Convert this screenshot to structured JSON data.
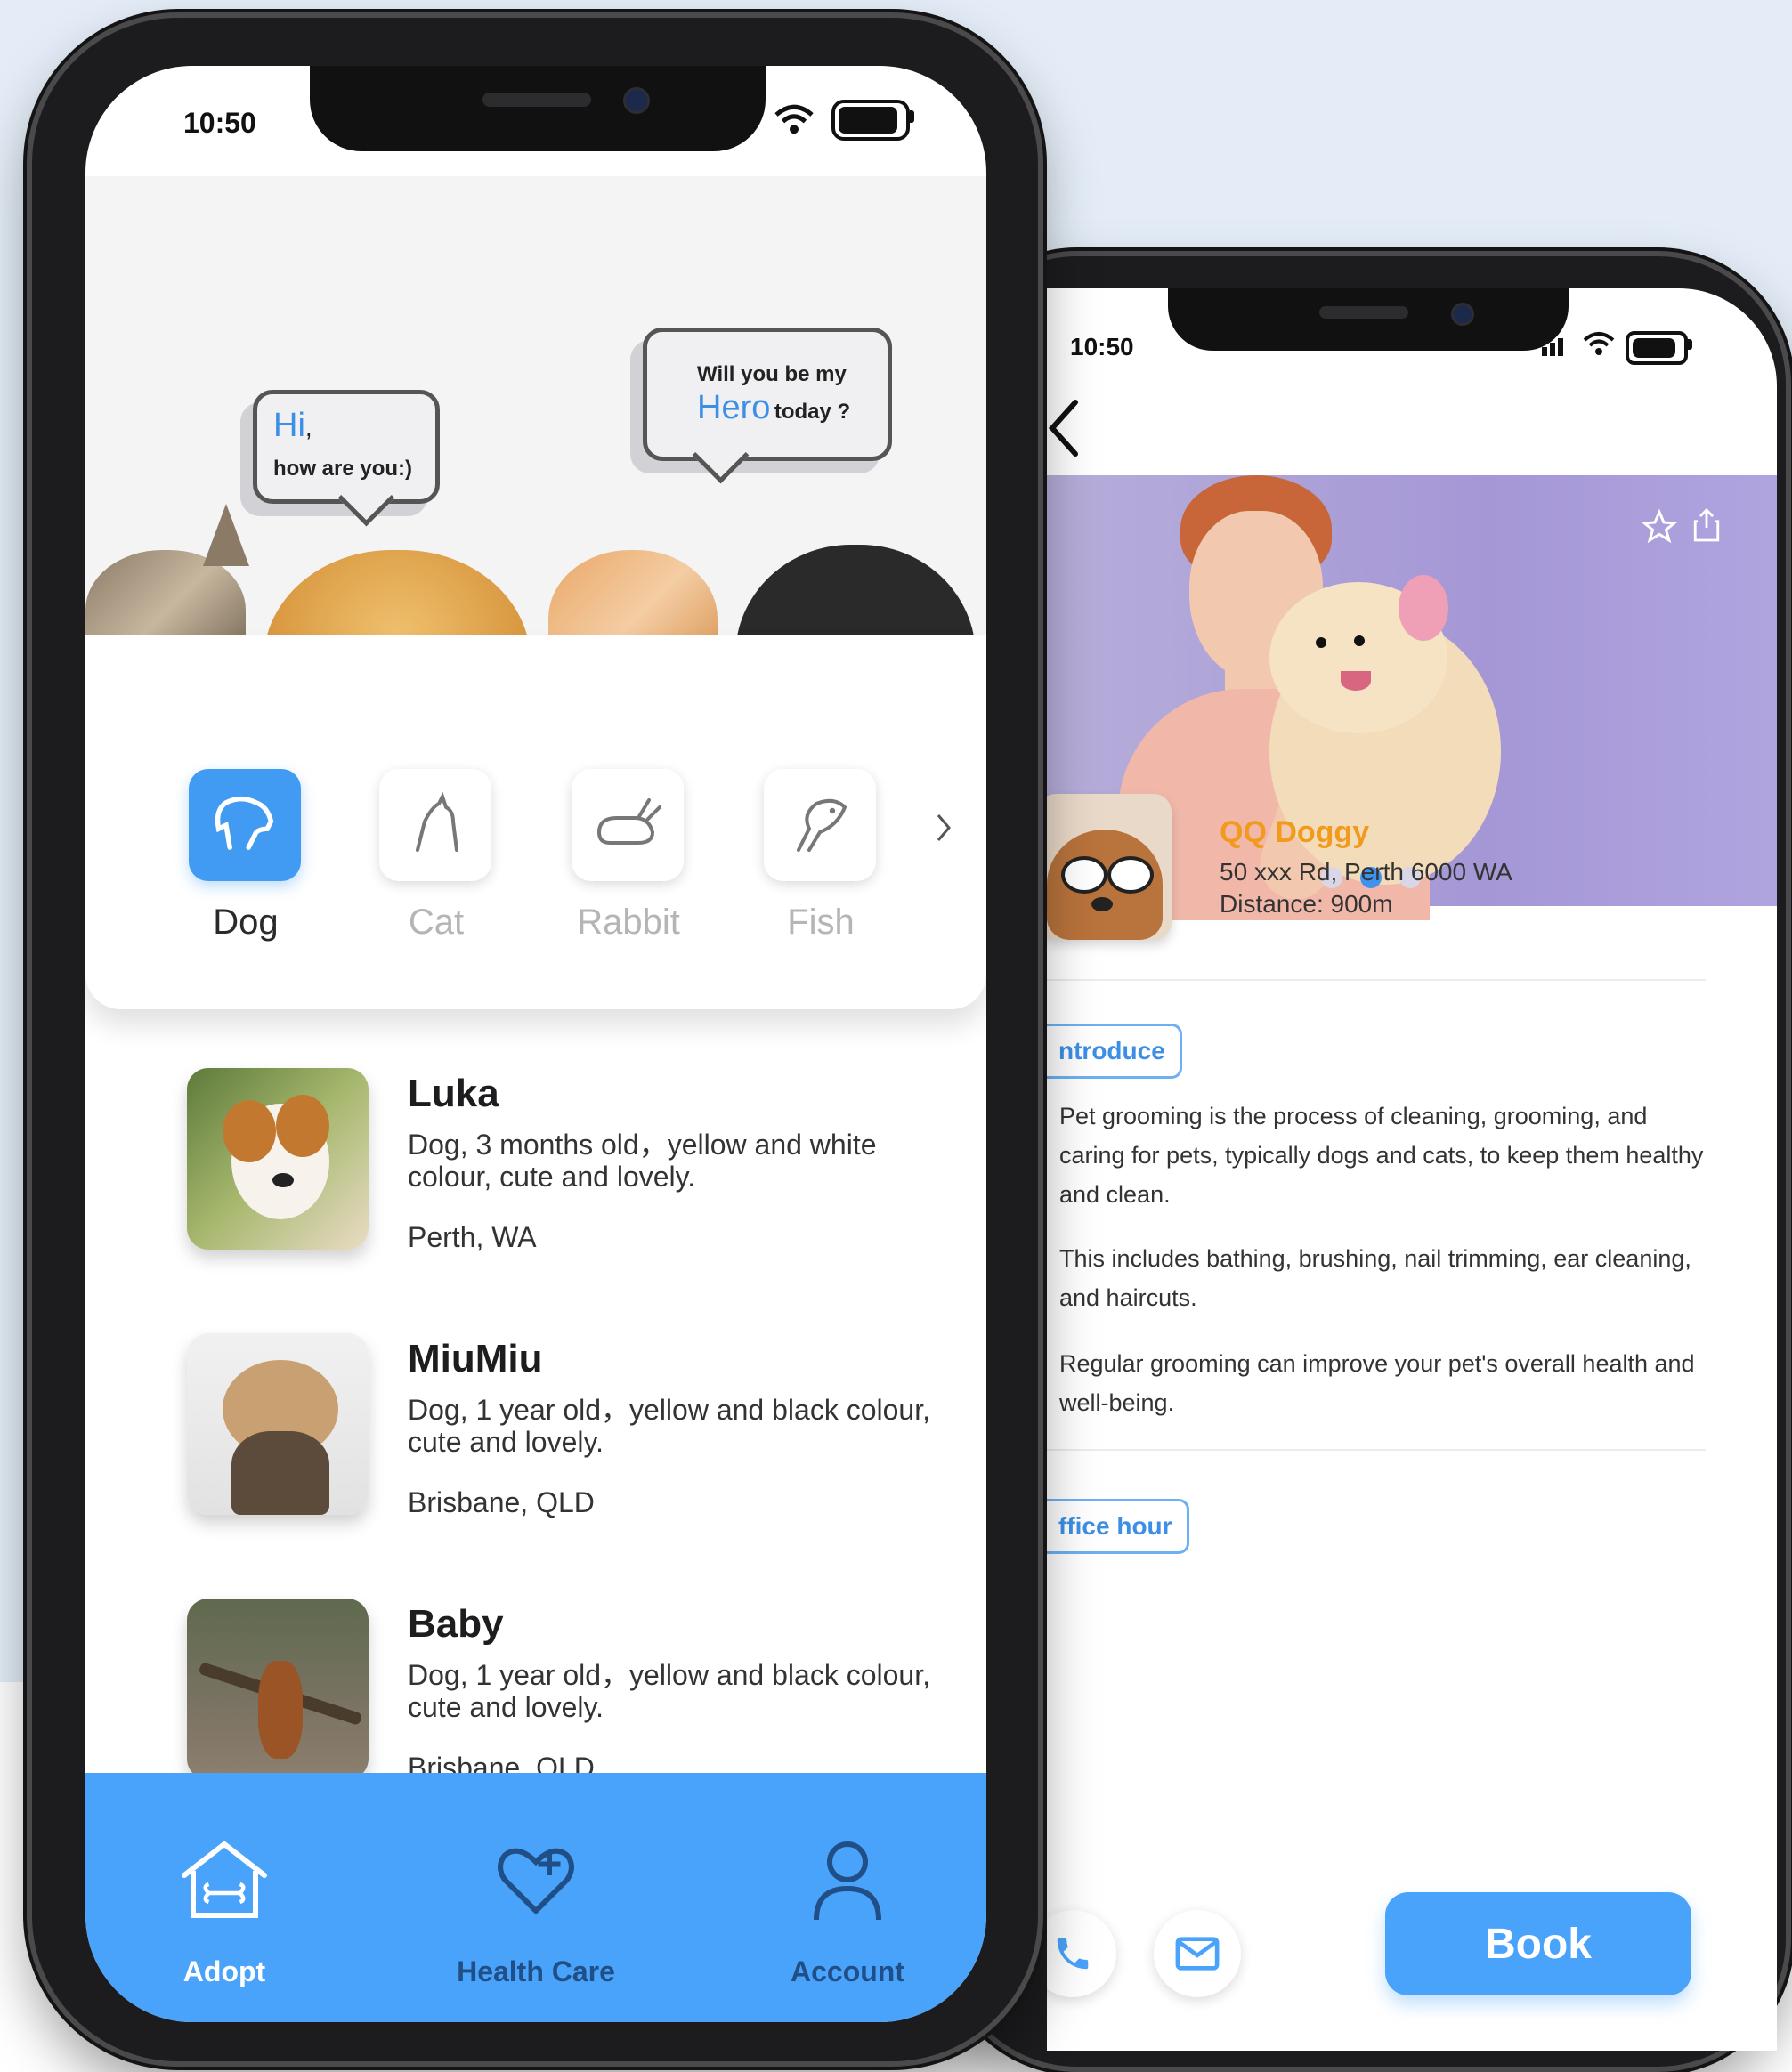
{
  "left_phone": {
    "status": {
      "time": "10:50"
    },
    "speech": {
      "left": {
        "greeting": "Hi",
        "comma": ",",
        "line2": "how are you:)"
      },
      "right": {
        "line1": "Will you be my",
        "hero": "Hero",
        "line2": "today ?"
      }
    },
    "categories": [
      {
        "label": "Dog",
        "icon": "dog-icon",
        "active": true
      },
      {
        "label": "Cat",
        "icon": "cat-icon",
        "active": false
      },
      {
        "label": "Rabbit",
        "icon": "rabbit-icon",
        "active": false
      },
      {
        "label": "Fish",
        "icon": "fish-icon",
        "active": false
      }
    ],
    "pets": [
      {
        "name": "Luka",
        "desc": "Dog, 3 months old，yellow and white colour, cute and lovely.",
        "location": "Perth, WA"
      },
      {
        "name": "MiuMiu",
        "desc": "Dog, 1 year old，yellow and black colour, cute and lovely.",
        "location": "Brisbane, QLD"
      },
      {
        "name": "Baby",
        "desc": "Dog, 1 year old，yellow and black colour, cute and lovely.",
        "location": "Brisbane, QLD"
      }
    ],
    "tabs": [
      {
        "label": "Adopt",
        "icon": "house-bone-icon"
      },
      {
        "label": "Health Care",
        "icon": "heart-plus-icon"
      },
      {
        "label": "Account",
        "icon": "person-icon"
      }
    ]
  },
  "right_phone": {
    "status": {
      "time": "10:50"
    },
    "shop": {
      "name": "QQ Doggy",
      "address": "50 xxx Rd, Perth 6000 WA",
      "distance": "Distance: 900m"
    },
    "sections": {
      "introduce": "ntroduce",
      "office_hour": "ffice hour"
    },
    "paragraphs": [
      "Pet grooming is the process of cleaning, grooming, and caring for pets, typically dogs and cats, to keep them healthy and clean.",
      "This includes bathing, brushing, nail trimming, ear cleaning, and haircuts.",
      "Regular grooming can improve your pet's overall health and well-being."
    ],
    "carousel": {
      "active_index": 1,
      "count": 3
    },
    "book_label": "Book",
    "colors": {
      "accent": "#4aa3fa",
      "shop_name": "#f19a1e",
      "hero_bg": "#a597d6"
    }
  }
}
